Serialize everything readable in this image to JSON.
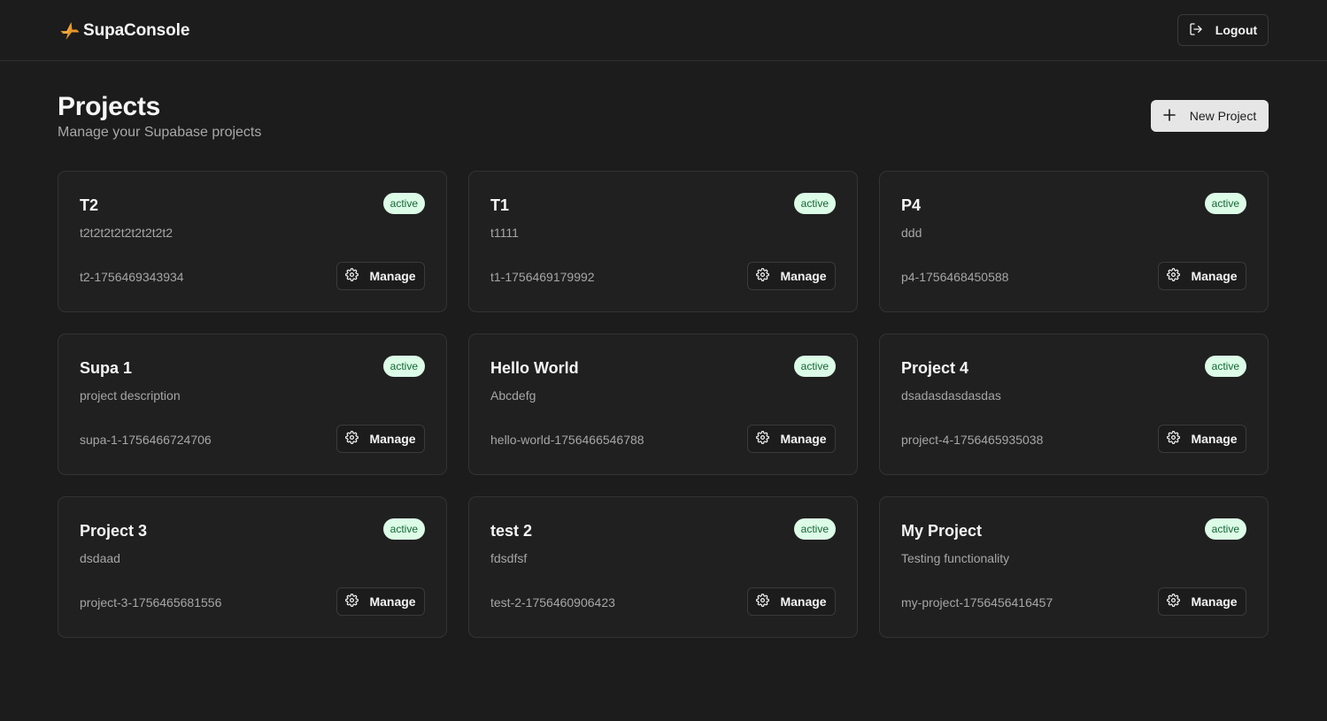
{
  "app": {
    "name": "SupaConsole",
    "logo_icon": "bolt-logo-icon",
    "brand_color": "#f59e0b"
  },
  "topbar": {
    "logout_label": "Logout",
    "logout_icon": "logout-icon"
  },
  "header": {
    "title": "Projects",
    "subtitle": "Manage your Supabase projects"
  },
  "actions": {
    "new_project_label": "New Project",
    "new_project_icon": "plus-icon"
  },
  "projects": [
    {
      "name": "T2",
      "description": "t2t2t2t2t2t2t2t2t2",
      "slug": "t2-1756469343934",
      "status": "active",
      "manage_label": "Manage"
    },
    {
      "name": "T1",
      "description": "t1111",
      "slug": "t1-1756469179992",
      "status": "active",
      "manage_label": "Manage"
    },
    {
      "name": "P4",
      "description": "ddd",
      "slug": "p4-1756468450588",
      "status": "active",
      "manage_label": "Manage"
    },
    {
      "name": "Supa 1",
      "description": "project description",
      "slug": "supa-1-1756466724706",
      "status": "active",
      "manage_label": "Manage"
    },
    {
      "name": "Hello World",
      "description": "Abcdefg",
      "slug": "hello-world-1756466546788",
      "status": "active",
      "manage_label": "Manage"
    },
    {
      "name": "Project 4",
      "description": "dsadasdasdasdas",
      "slug": "project-4-1756465935038",
      "status": "active",
      "manage_label": "Manage"
    },
    {
      "name": "Project 3",
      "description": "dsdaad",
      "slug": "project-3-1756465681556",
      "status": "active",
      "manage_label": "Manage"
    },
    {
      "name": "test 2",
      "description": "fdsdfsf",
      "slug": "test-2-1756460906423",
      "status": "active",
      "manage_label": "Manage"
    },
    {
      "name": "My Project",
      "description": "Testing functionality",
      "slug": "my-project-1756456416457",
      "status": "active",
      "manage_label": "Manage"
    }
  ],
  "colors": {
    "background": "#1c1c1c",
    "card": "#202020",
    "badge_bg": "#dcfce7",
    "badge_text": "#166534"
  }
}
